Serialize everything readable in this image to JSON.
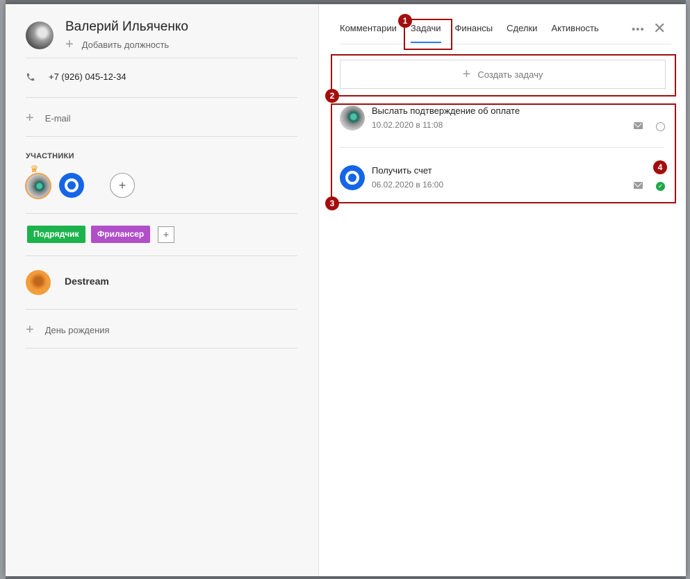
{
  "contact": {
    "name": "Валерий Ильяченко",
    "add_position_label": "Добавить должность",
    "phone": "+7 (926) 045-12-34",
    "add_email_label": "E-mail",
    "participants_title": "УЧАСТНИКИ",
    "tags": [
      "Подрядчик",
      "Фрилансер"
    ],
    "company": "Destream",
    "add_birthday_label": "День рождения"
  },
  "tabs": [
    "Комментарии",
    "Задачи",
    "Финансы",
    "Сделки",
    "Активность"
  ],
  "active_tab": "Задачи",
  "tasks": {
    "create_label": "Создать задачу",
    "items": [
      {
        "title": "Выслать подтверждение об оплате",
        "date": "10.02.2020 в 11:08",
        "done": false
      },
      {
        "title": "Получить счет",
        "date": "06.02.2020 в 16:00",
        "done": true
      }
    ]
  },
  "annotations": [
    "1",
    "2",
    "3",
    "4"
  ],
  "colors": {
    "tag_green": "#1cb34c",
    "tag_purple": "#b04fc7",
    "active_tab_underline": "#2b7be5",
    "annotation_red": "#a30d0d",
    "done_green": "#1fa84a"
  },
  "icons": {
    "phone": "phone-icon",
    "more": "more-icon",
    "close": "close-icon",
    "mail": "mail-icon",
    "crown": "crown-icon"
  }
}
